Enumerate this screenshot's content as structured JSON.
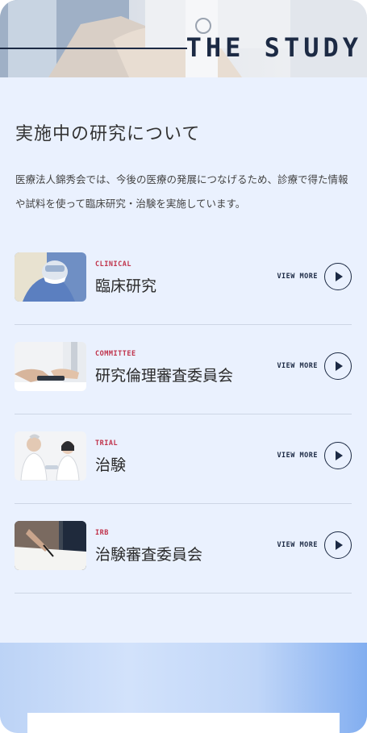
{
  "hero": {
    "title": "THE STUDY"
  },
  "section": {
    "title": "実施中の研究について",
    "description": "医療法人錦秀会では、今後の医療の発展につなげるため、診療で得た情報や試料を使って臨床研究・治験を実施しています。"
  },
  "studies": [
    {
      "category": "CLINICAL",
      "name": "臨床研究",
      "more": "VIEW MORE",
      "thumb_icon": "surgeon-mask-photo"
    },
    {
      "category": "COMMITTEE",
      "name": "研究倫理審査委員会",
      "more": "VIEW MORE",
      "thumb_icon": "hands-tablet-photo"
    },
    {
      "category": "TRIAL",
      "name": "治験",
      "more": "VIEW MORE",
      "thumb_icon": "doctor-nurse-photo"
    },
    {
      "category": "IRB",
      "name": "治験審査委員会",
      "more": "VIEW MORE",
      "thumb_icon": "signing-document-photo"
    }
  ],
  "colors": {
    "accent": "#c0334b",
    "navy": "#1c2a44",
    "background": "#eaf1fe"
  }
}
